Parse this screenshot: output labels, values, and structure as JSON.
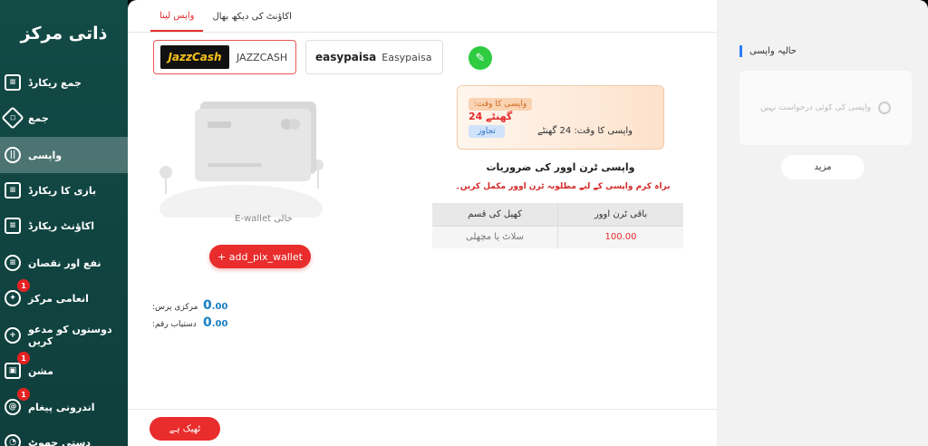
{
  "sidebar": {
    "title": "ذاتی مرکز",
    "items": [
      {
        "label": "جمع ریکارڈ",
        "icon": "deposit-record-icon"
      },
      {
        "label": "جمع",
        "icon": "deposit-icon"
      },
      {
        "label": "واپسی",
        "icon": "withdraw-icon",
        "active": true
      },
      {
        "label": "بازی کا ریکارڈ",
        "icon": "game-record-icon"
      },
      {
        "label": "اکاؤنٹ ریکارڈ",
        "icon": "account-record-icon"
      },
      {
        "label": "نفع اور نقصان",
        "icon": "profit-loss-icon"
      },
      {
        "label": "انعامی مرکز",
        "icon": "reward-center-icon",
        "badge": "1"
      },
      {
        "label": "دوستوں کو مدعو کریں",
        "icon": "invite-friends-icon"
      },
      {
        "label": "مشن",
        "icon": "gift-icon",
        "badge": "1"
      },
      {
        "label": "اندرونی پیغام",
        "icon": "message-icon",
        "badge": "1"
      },
      {
        "label": "دستی جھوٹ",
        "icon": "manual-icon"
      }
    ]
  },
  "tabs": [
    "واپس لینا",
    "اکاؤنٹ کی دیکھ بھال"
  ],
  "wallets": {
    "jazz_logo": "JazzCash",
    "jazz_name": "JAZZCASH",
    "ep_logo": "easypaisa",
    "ep_name": "Easypaisa"
  },
  "empty_wallet": "E-wallet خالی",
  "add_button": "+ add_pix_wallet",
  "balances": {
    "central_label": ":مرکزی پرس",
    "central_value": "0",
    "central_dec": ".00",
    "available_label": ":دستیاب رقم",
    "available_value": "0",
    "available_dec": ".00"
  },
  "withdraw_time": {
    "tag": ":واپسی کا وقت",
    "big": "24 گھنٹے",
    "line": "واپسی کا وقت: 24 گھنٹے",
    "chip": "تجاوز"
  },
  "requirements": {
    "title": "واپسی ٹرن اوور کی ضروریات",
    "note": "براہ کرم واپسی کے لیے مطلوبہ ٹرن اوور مکمل کریں۔",
    "headers": [
      "باقی ٹرن اوور",
      "کھیل کی قسم"
    ],
    "row": [
      "100.00",
      "سلاٹ یا مچھلی"
    ]
  },
  "ok_button": "ٹھیک ہے",
  "right": {
    "title": "حالیہ واپسی",
    "empty": "واپسی کی کوئی درخواست نہیں",
    "more": "مزید"
  }
}
